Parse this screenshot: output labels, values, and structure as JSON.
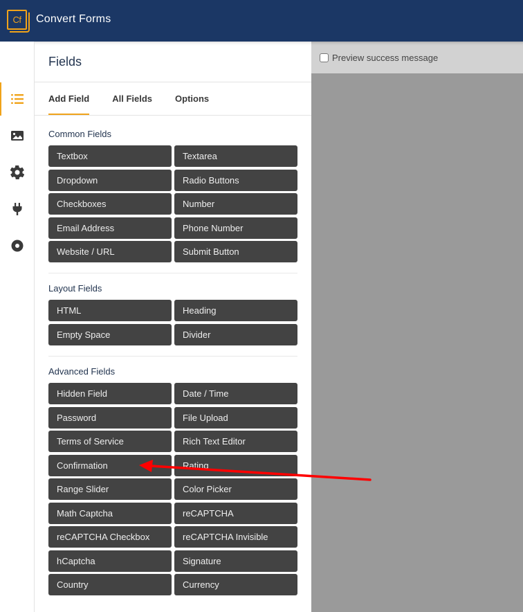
{
  "app": {
    "title": "Convert Forms",
    "logo_text": "Cf",
    "brand_color": "#1b3765",
    "accent_color": "#f0a31a"
  },
  "rail": {
    "items": [
      {
        "icon": "list-icon",
        "active": true
      },
      {
        "icon": "image-icon",
        "active": false
      },
      {
        "icon": "gear-icon",
        "active": false
      },
      {
        "icon": "plug-icon",
        "active": false
      },
      {
        "icon": "circle-dot-icon",
        "active": false
      }
    ]
  },
  "panel": {
    "title": "Fields",
    "tabs": [
      {
        "label": "Add Field",
        "active": true
      },
      {
        "label": "All Fields",
        "active": false
      },
      {
        "label": "Options",
        "active": false
      }
    ],
    "sections": [
      {
        "title": "Common Fields",
        "fields": [
          "Textbox",
          "Textarea",
          "Dropdown",
          "Radio Buttons",
          "Checkboxes",
          "Number",
          "Email Address",
          "Phone Number",
          "Website / URL",
          "Submit Button"
        ]
      },
      {
        "title": "Layout Fields",
        "fields": [
          "HTML",
          "Heading",
          "Empty Space",
          "Divider"
        ]
      },
      {
        "title": "Advanced Fields",
        "fields": [
          "Hidden Field",
          "Date / Time",
          "Password",
          "File Upload",
          "Terms of Service",
          "Rich Text Editor",
          "Confirmation",
          "Rating",
          "Range Slider",
          "Color Picker",
          "Math Captcha",
          "reCAPTCHA",
          "reCAPTCHA Checkbox",
          "reCAPTCHA Invisible",
          "hCaptcha",
          "Signature",
          "Country",
          "Currency"
        ]
      }
    ]
  },
  "preview": {
    "checkbox_label": "Preview success message",
    "checked": false
  },
  "annotation": {
    "type": "arrow",
    "color": "#ff0000",
    "points_to": "Confirmation"
  }
}
